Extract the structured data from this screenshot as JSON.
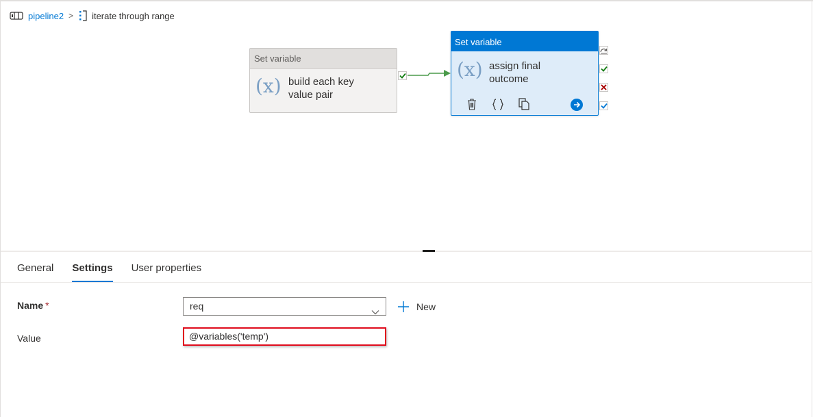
{
  "breadcrumb": {
    "pipeline": "pipeline2",
    "separator": ">",
    "activity": "iterate through range"
  },
  "canvas": {
    "nodes": [
      {
        "type_label": "Set variable",
        "title_line1": "build each key",
        "title_line2": "value pair",
        "glyph": "(x)",
        "state": "unselected"
      },
      {
        "type_label": "Set variable",
        "title_line1": "assign final",
        "title_line2": "outcome",
        "glyph": "(x)",
        "state": "selected"
      }
    ],
    "icons": {
      "actions": [
        "delete-icon",
        "code-icon",
        "copy-icon",
        "go-arrow-icon"
      ],
      "ports": [
        "skip-port-icon",
        "success-port-icon",
        "failure-port-icon",
        "completion-port-icon"
      ]
    },
    "colors": {
      "accent": "#0078d4",
      "success": "#107c10",
      "failure": "#a80000",
      "connector": "#4a9a4a"
    }
  },
  "tabs": [
    {
      "label": "General",
      "active": false
    },
    {
      "label": "Settings",
      "active": true
    },
    {
      "label": "User properties",
      "active": false
    }
  ],
  "settings": {
    "name_label": "Name",
    "required_marker": "*",
    "name_value": "req",
    "new_label": "New",
    "value_label": "Value",
    "value_text": "@variables('temp')",
    "highlight_color": "#e00b1c"
  }
}
